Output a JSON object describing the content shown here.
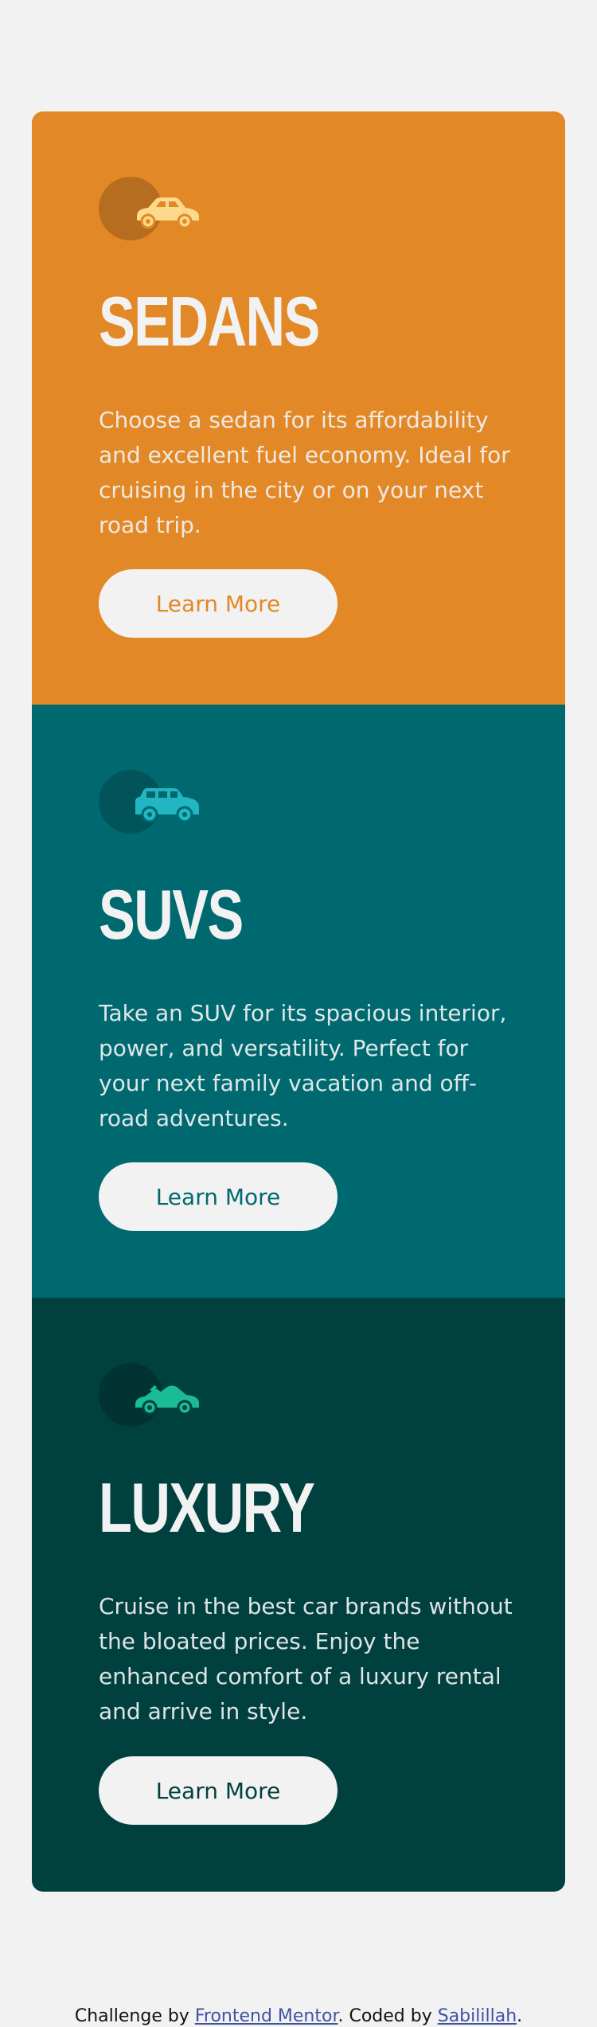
{
  "cards": [
    {
      "title": "SEDANS",
      "text": "Choose a sedan for its affordability and excellent fuel economy. Ideal for cruising in the city or on your next road trip.",
      "button_label": "Learn More",
      "icon": "sedan-car-icon",
      "color": "#e38826"
    },
    {
      "title": "SUVS",
      "text": "Take an SUV for its spacious interior, power, and versatility. Perfect for your next family vacation and off-road adventures.",
      "button_label": "Learn More",
      "icon": "suv-car-icon",
      "color": "#006970"
    },
    {
      "title": "LUXURY",
      "text": "Cruise in the best car brands without the bloated prices. Enjoy the enhanced comfort of a luxury rental and arrive in style.",
      "button_label": "Learn More",
      "icon": "luxury-car-icon",
      "color": "#004140"
    }
  ],
  "footer": {
    "prefix": "Challenge by ",
    "challenge_link": "Frontend Mentor",
    "middle": ". Coded by ",
    "author_link": "Sabilillah",
    "suffix": "."
  },
  "colors": {
    "background": "#f2f2f2",
    "sedan_accent": "#e38826",
    "suv_accent": "#006970",
    "luxury_accent": "#004140",
    "sedan_icon": "#fdd98b",
    "suv_icon": "#22b6c3",
    "luxury_icon": "#1abb95"
  }
}
